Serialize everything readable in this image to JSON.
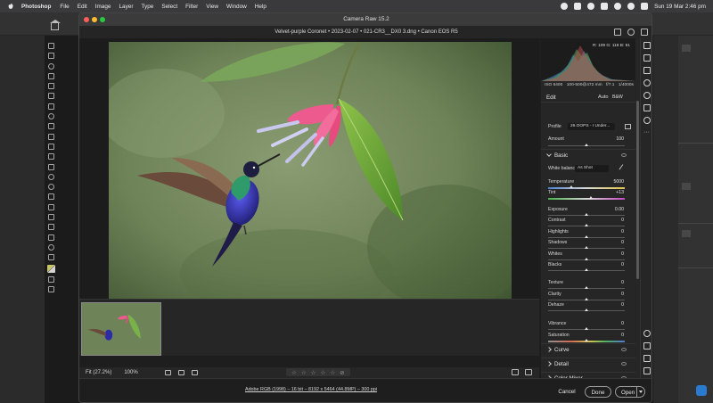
{
  "menubar": {
    "app_name": "Photoshop",
    "items": [
      "File",
      "Edit",
      "Image",
      "Layer",
      "Type",
      "Select",
      "Filter",
      "View",
      "Window",
      "Help"
    ],
    "clock": "Sun 19 Mar  2:46 pm"
  },
  "dialog": {
    "title": "Camera Raw 15.2",
    "file_info": "Velvet-purple Coronet  •  2023-02-07  •  021-CR3__DX0 3.dng  •  Canon EOS R5",
    "workflow_info": "Adobe RGB (1998) – 16 bit – 8192 x 5464 (44.8MP) – 300 ppi",
    "buttons": {
      "cancel": "Cancel",
      "done": "Done",
      "open": "Open"
    }
  },
  "viewbar": {
    "fit_label": "Fit (27.2%)",
    "zoom_label": "100%",
    "stars": [
      "☆",
      "☆",
      "☆",
      "☆",
      "☆"
    ]
  },
  "histogram": {
    "rgb": "R: 109   G: 118   B: 91",
    "camera_line": [
      "ISO 6400",
      "100-500@472 mm",
      "f/7.1",
      "1/4000s"
    ]
  },
  "edit": {
    "title": "Edit",
    "auto_label": "Auto",
    "bw_label": "B&W",
    "profile_label": "Profile",
    "profile_value": "26.OOPS - I Under...",
    "amount_label": "Amount",
    "amount_value": "100",
    "amount_pos": 0.5,
    "basic": {
      "title": "Basic",
      "wb_label": "White balance",
      "wb_value": "As Shot",
      "sliders": [
        {
          "label": "Temperature",
          "value": "5000",
          "pos": 0.3
        },
        {
          "label": "Tint",
          "value": "+13",
          "pos": 0.56
        },
        {
          "label": "Exposure",
          "value": "0.00",
          "pos": 0.5
        },
        {
          "label": "Contrast",
          "value": "0",
          "pos": 0.5
        },
        {
          "label": "Highlights",
          "value": "0",
          "pos": 0.5
        },
        {
          "label": "Shadows",
          "value": "0",
          "pos": 0.5
        },
        {
          "label": "Whites",
          "value": "0",
          "pos": 0.5
        },
        {
          "label": "Blacks",
          "value": "0",
          "pos": 0.5
        },
        {
          "label": "Texture",
          "value": "0",
          "pos": 0.5
        },
        {
          "label": "Clarity",
          "value": "0",
          "pos": 0.5
        },
        {
          "label": "Dehaze",
          "value": "0",
          "pos": 0.5
        },
        {
          "label": "Vibrance",
          "value": "0",
          "pos": 0.5
        },
        {
          "label": "Saturation",
          "value": "0",
          "pos": 0.5
        }
      ]
    },
    "sections": [
      "Curve",
      "Detail",
      "Color Mixer"
    ]
  },
  "colors": {
    "accent": "#4a90e2",
    "leaf": "#6aa83a",
    "flower": "#e8497e",
    "bird": "#2b2b9a"
  }
}
